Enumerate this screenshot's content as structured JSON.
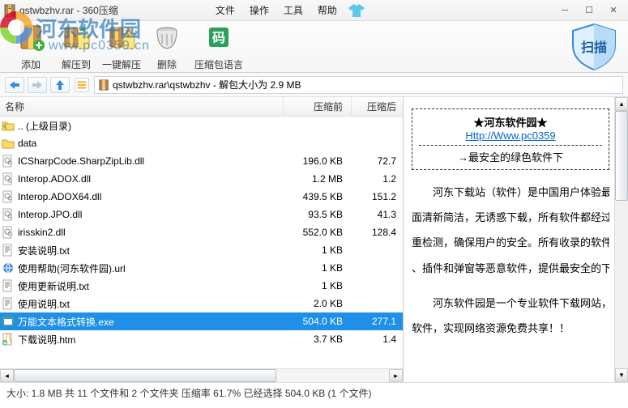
{
  "window": {
    "title": "qstwbzhv.rar - 360压缩"
  },
  "menu": {
    "file": "文件",
    "operate": "操作",
    "tools": "工具",
    "help": "帮助"
  },
  "toolbar": {
    "add": "添加",
    "extract_to": "解压到",
    "oneclick_extract": "一键解压",
    "delete": "删除",
    "lang": "压缩包语言",
    "scan": "扫描"
  },
  "path": {
    "value": "qstwbzhv.rar\\qstwbzhv - 解包大小为 2.9 MB"
  },
  "columns": {
    "name": "名称",
    "before": "压缩前",
    "after": "压缩后"
  },
  "files": [
    {
      "icon": "folder-up",
      "name": ".. (上级目录)",
      "before": "",
      "after": ""
    },
    {
      "icon": "folder",
      "name": "data",
      "before": "",
      "after": ""
    },
    {
      "icon": "dll",
      "name": "ICSharpCode.SharpZipLib.dll",
      "before": "196.0 KB",
      "after": "72.7"
    },
    {
      "icon": "dll",
      "name": "Interop.ADOX.dll",
      "before": "1.2 MB",
      "after": "1.2"
    },
    {
      "icon": "dll",
      "name": "Interop.ADOX64.dll",
      "before": "439.5 KB",
      "after": "151.2"
    },
    {
      "icon": "dll",
      "name": "Interop.JPO.dll",
      "before": "93.5 KB",
      "after": "41.3"
    },
    {
      "icon": "dll",
      "name": "irisskin2.dll",
      "before": "552.0 KB",
      "after": "128.4"
    },
    {
      "icon": "txt",
      "name": "安装说明.txt",
      "before": "1 KB",
      "after": ""
    },
    {
      "icon": "url",
      "name": "使用帮助(河东软件园).url",
      "before": "1 KB",
      "after": ""
    },
    {
      "icon": "txt",
      "name": "使用更新说明.txt",
      "before": "1 KB",
      "after": ""
    },
    {
      "icon": "txt",
      "name": "使用说明.txt",
      "before": "2.0 KB",
      "after": ""
    },
    {
      "icon": "exe",
      "name": "万能文本格式转换.exe",
      "before": "504.0 KB",
      "after": "277.1",
      "selected": true
    },
    {
      "icon": "htm",
      "name": "下载说明.htm",
      "before": "3.7 KB",
      "after": "1.4"
    }
  ],
  "side": {
    "title": "★河东软件园★",
    "url": "Http://Www.pc0359",
    "tagline": "→最安全的绿色软件下",
    "p1": "　　河东下载站（软件）是中国用户体验最好",
    "p2": "面清新简洁，无诱惑下载，所有软件都经过多",
    "p3": "重检测，确保用户的安全。所有收录的软件都",
    "p4": "、插件和弹窗等恶意软件，提供最安全的下载",
    "p5": "　　河东软件园是一个专业软件下载网站，大",
    "p6": "软件，实现网络资源免费共享！！"
  },
  "status": {
    "text": "大小: 1.8 MB 共 11 个文件和 2 个文件夹 压缩率 61.7%  已经选择 504.0 KB (1 个文件)"
  },
  "watermark": {
    "brand": "河东软件园",
    "url": "www.pc0359.cn"
  }
}
